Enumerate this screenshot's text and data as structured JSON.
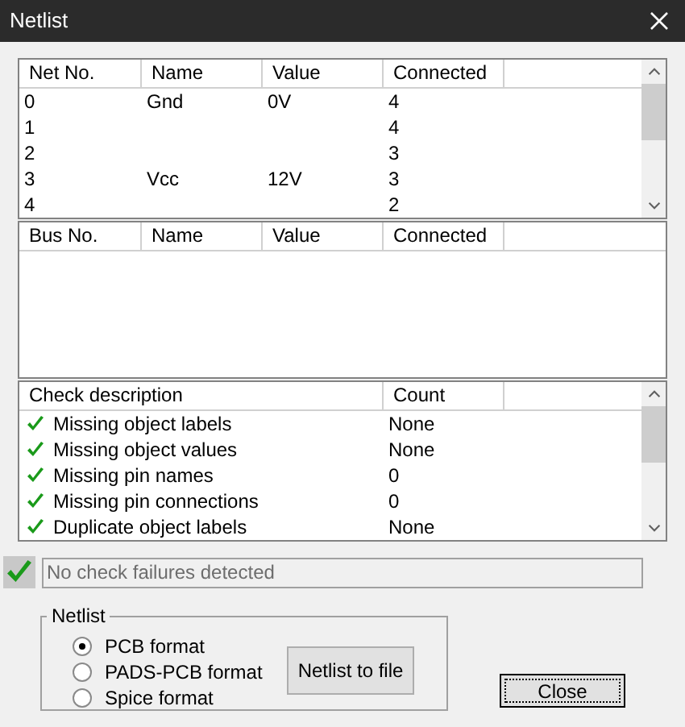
{
  "window": {
    "title": "Netlist"
  },
  "net_table": {
    "columns": [
      "Net No.",
      "Name",
      "Value",
      "Connected"
    ],
    "rows": [
      [
        "0",
        "Gnd",
        "0V",
        "4"
      ],
      [
        "1",
        "",
        "",
        "4"
      ],
      [
        "2",
        "",
        "",
        "3"
      ],
      [
        "3",
        "Vcc",
        "12V",
        "3"
      ],
      [
        "4",
        "",
        "",
        "2"
      ]
    ]
  },
  "bus_table": {
    "columns": [
      "Bus No.",
      "Name",
      "Value",
      "Connected"
    ]
  },
  "check_table": {
    "columns": [
      "Check description",
      "Count"
    ],
    "rows": [
      {
        "description": "Missing object labels",
        "count": "None",
        "passed": true
      },
      {
        "description": "Missing object values",
        "count": "None",
        "passed": true
      },
      {
        "description": "Missing pin names",
        "count": "0",
        "passed": true
      },
      {
        "description": "Missing pin connections",
        "count": "0",
        "passed": true
      },
      {
        "description": "Duplicate object labels",
        "count": "None",
        "passed": true
      }
    ]
  },
  "status": {
    "passed": true,
    "message": "No check failures detected"
  },
  "netlist_group": {
    "title": "Netlist",
    "formats": [
      {
        "label": "PCB format",
        "selected": true
      },
      {
        "label": "PADS-PCB format",
        "selected": false
      },
      {
        "label": "Spice format",
        "selected": false
      }
    ],
    "export_button": "Netlist to file"
  },
  "close_button": "Close"
}
